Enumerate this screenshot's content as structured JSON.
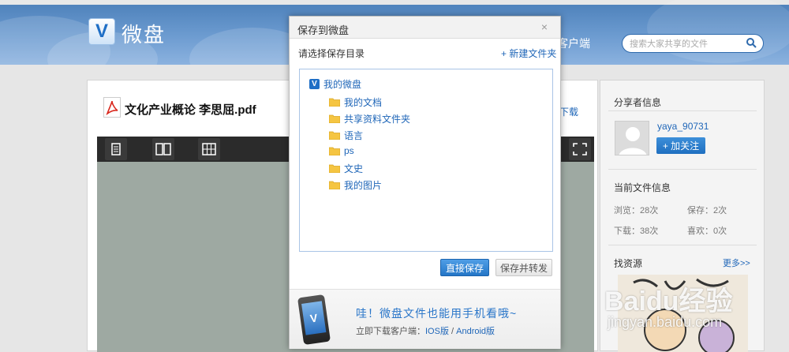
{
  "header": {
    "logo_letter": "V",
    "logo_text": "微盘",
    "nav_client": "客户端",
    "search_placeholder": "搜索大家共享的文件"
  },
  "document": {
    "title": "文化产业概论 李思屈.pdf",
    "download_label": "下载",
    "toolbar_icons": [
      "single-page-icon",
      "two-page-icon",
      "grid-view-icon",
      "fullscreen-icon"
    ]
  },
  "sidebar": {
    "sharer_heading": "分享者信息",
    "username": "yaya_90731",
    "follow_label": "+ 加关注",
    "file_info_heading": "当前文件信息",
    "stats": {
      "views": "浏览：28次",
      "saves": "保存：2次",
      "downloads": "下载：38次",
      "likes": "喜欢：0次"
    },
    "resources_heading": "找资源",
    "more_label": "更多>>"
  },
  "dialog": {
    "title": "保存到微盘",
    "close": "×",
    "subtitle": "请选择保存目录",
    "new_folder": "+ 新建文件夹",
    "root_label": "我的微盘",
    "folders": [
      "我的文档",
      "共享资料文件夹",
      "语言",
      "ps",
      "文史",
      "我的图片"
    ],
    "save_button": "直接保存",
    "save_forward_button": "保存并转发",
    "promo_title": "哇！微盘文件也能用手机看哦~",
    "promo_prefix": "立即下载客户端：",
    "promo_ios": "IOS版",
    "promo_sep": " / ",
    "promo_android": "Android版"
  },
  "watermark": {
    "brand": "Baidu经验",
    "url": "jingyan.baidu.com"
  },
  "colors": {
    "header_blue": "#5f8fc8",
    "link_blue": "#1f66b8",
    "primary_button": "#2476c7"
  }
}
